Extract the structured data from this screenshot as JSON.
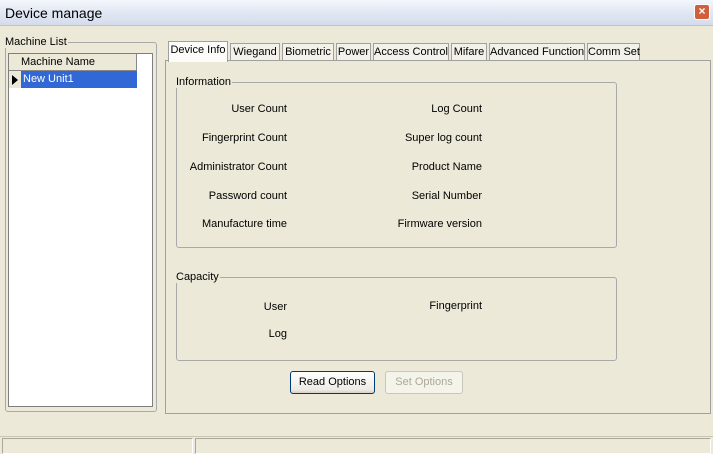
{
  "window": {
    "title": "Device manage",
    "close_glyph": "×"
  },
  "machine_list": {
    "legend": "Machine List",
    "column_header": "Machine Name",
    "rows": [
      {
        "name": "New Unit1",
        "selected": true
      }
    ]
  },
  "tabs": [
    {
      "label": "Device Info",
      "active": true
    },
    {
      "label": "Wiegand",
      "active": false
    },
    {
      "label": "Biometric",
      "active": false
    },
    {
      "label": "Power",
      "active": false
    },
    {
      "label": "Access Control",
      "active": false
    },
    {
      "label": "Mifare",
      "active": false
    },
    {
      "label": "Advanced Function",
      "active": false
    },
    {
      "label": "Comm Set",
      "active": false
    }
  ],
  "information": {
    "legend": "Information",
    "left_labels": [
      "User Count",
      "Fingerprint Count",
      "Administrator Count",
      "Password count",
      "Manufacture time"
    ],
    "right_labels": [
      "Log Count",
      "Super log count",
      "Product Name",
      "Serial Number",
      "Firmware version"
    ]
  },
  "capacity": {
    "legend": "Capacity",
    "user_label": "User",
    "fingerprint_label": "Fingerprint",
    "log_label": "Log"
  },
  "buttons": {
    "read_options": "Read Options",
    "set_options": "Set Options"
  },
  "colors": {
    "selection": "#3168d6",
    "window_bg": "#ece9d8",
    "close_button": "#d0603c"
  }
}
